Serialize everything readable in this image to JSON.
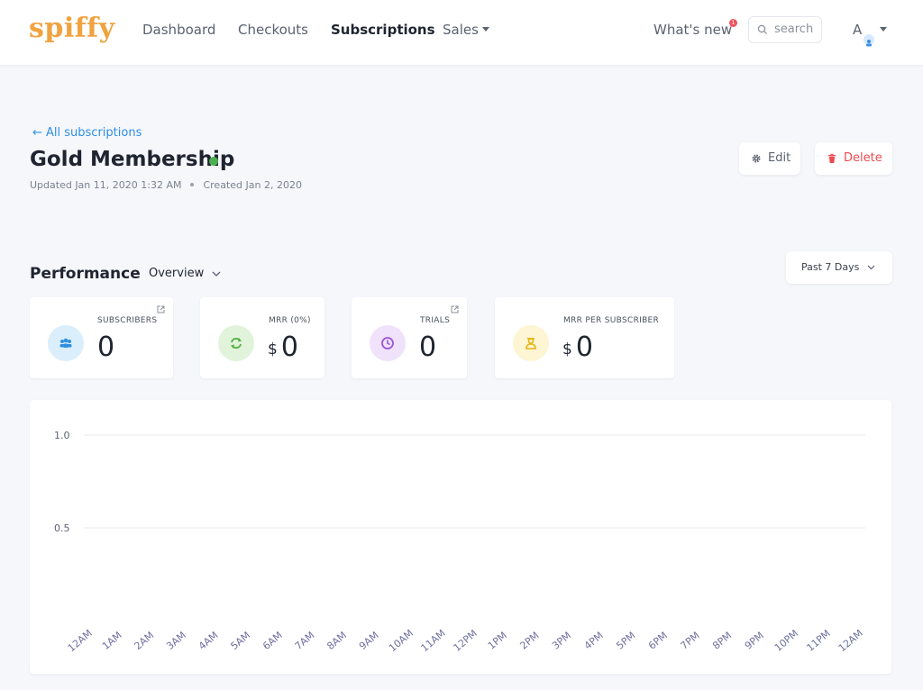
{
  "nav": {
    "logo": "spiffy",
    "links": {
      "dashboard": "Dashboard",
      "checkouts": "Checkouts",
      "subscriptions": "Subscriptions",
      "sales": "Sales"
    },
    "whats_new": "What's new",
    "notification_count": "1",
    "search_placeholder": "search",
    "avatar_initial": "A"
  },
  "header": {
    "back_link": "← All subscriptions",
    "title": "Gold Membership",
    "updated": "Updated Jan 11, 2020 1:32 AM",
    "created": "Created Jan 2, 2020",
    "edit_label": "Edit",
    "delete_label": "Delete"
  },
  "performance": {
    "title": "Performance",
    "view": "Overview",
    "range": "Past 7 Days"
  },
  "stats": {
    "subscribers": {
      "label": "SUBSCRIBERS",
      "value": "0"
    },
    "mrr": {
      "label": "MRR (0%)",
      "currency": "$",
      "value": "0"
    },
    "trials": {
      "label": "TRIALS",
      "value": "0"
    },
    "mrr_per_subscriber": {
      "label": "MRR PER SUBSCRIBER",
      "currency": "$",
      "value": "0"
    }
  },
  "colors": {
    "brand": "#f0a340",
    "link": "#2f8fe0",
    "delete": "#ec4a52",
    "status_active": "#4caf50"
  },
  "chart_data": {
    "type": "line",
    "categories": [
      "12AM",
      "1AM",
      "2AM",
      "3AM",
      "4AM",
      "5AM",
      "6AM",
      "7AM",
      "8AM",
      "9AM",
      "10AM",
      "11AM",
      "12PM",
      "1PM",
      "2PM",
      "3PM",
      "4PM",
      "5PM",
      "6PM",
      "7PM",
      "8PM",
      "9PM",
      "10PM",
      "11PM",
      "12AM"
    ],
    "series": [],
    "yticks": [
      "1.0",
      "0.5"
    ],
    "yvalues": [
      1.0,
      0.5
    ],
    "ylim": [
      0,
      1.0
    ],
    "grid": true
  }
}
